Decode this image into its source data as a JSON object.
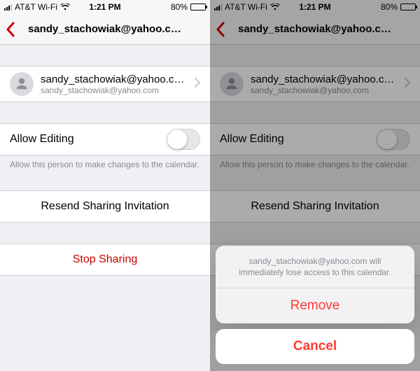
{
  "status": {
    "carrier": "AT&T Wi-Fi",
    "time": "1:21 PM",
    "battery_pct": "80%",
    "battery_fill_css_width": "80%"
  },
  "nav": {
    "title": "sandy_stachowiak@yahoo.com"
  },
  "person": {
    "primary": "sandy_stachowiak@yahoo.com",
    "secondary": "sandy_stachowiak@yahoo.com"
  },
  "editing": {
    "label": "Allow Editing",
    "footer": "Allow this person to make changes to the calendar."
  },
  "actions": {
    "resend": "Resend Sharing Invitation",
    "stop": "Stop Sharing"
  },
  "sheet": {
    "message": "sandy_stachowiak@yahoo.com will immediately lose access to this calendar.",
    "remove": "Remove",
    "cancel": "Cancel"
  }
}
